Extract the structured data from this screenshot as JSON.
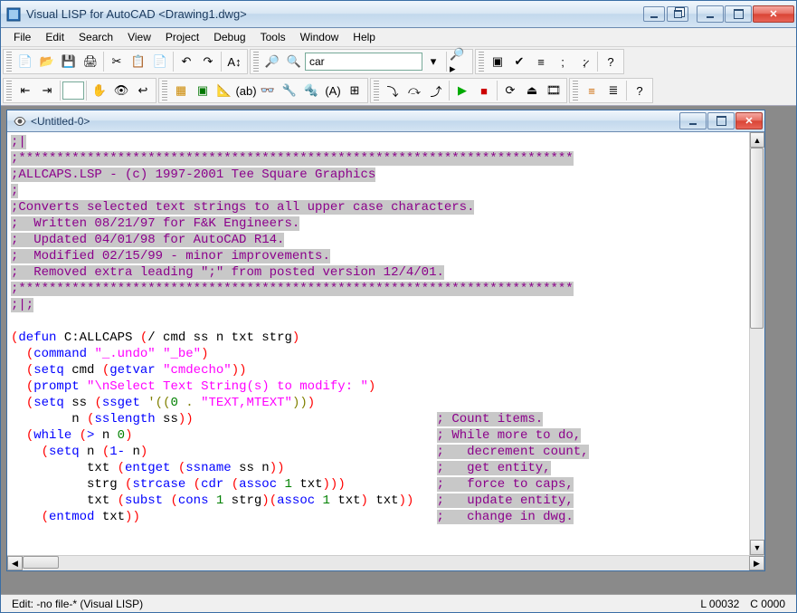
{
  "window": {
    "title": "Visual LISP for AutoCAD <Drawing1.dwg>"
  },
  "menu": {
    "items": [
      "File",
      "Edit",
      "Search",
      "View",
      "Project",
      "Debug",
      "Tools",
      "Window",
      "Help"
    ]
  },
  "toolbar": {
    "search_value": "car"
  },
  "child": {
    "title": "<Untitled-0>"
  },
  "code": {
    "lines": [
      {
        "t": "cmt",
        "raw": ";|"
      },
      {
        "t": "cmt",
        "raw": ";*************************************************************************"
      },
      {
        "t": "cmt",
        "raw": ";ALLCAPS.LSP - (c) 1997-2001 Tee Square Graphics"
      },
      {
        "t": "cmt",
        "raw": ";"
      },
      {
        "t": "cmt",
        "raw": ";Converts selected text strings to all upper case characters."
      },
      {
        "t": "cmt",
        "raw": ";  Written 08/21/97 for F&K Engineers."
      },
      {
        "t": "cmt",
        "raw": ";  Updated 04/01/98 for AutoCAD R14."
      },
      {
        "t": "cmt",
        "raw": ";  Modified 02/15/99 - minor improvements."
      },
      {
        "t": "cmt",
        "raw": ";  Removed extra leading \";\" from posted version 12/4/01."
      },
      {
        "t": "cmt",
        "raw": ";*************************************************************************"
      },
      {
        "t": "cmt",
        "raw": ";|;"
      },
      {
        "t": "blank",
        "raw": ""
      },
      {
        "t": "code",
        "seg": [
          [
            "paren",
            "("
          ],
          [
            "func",
            "defun"
          ],
          [
            "sym",
            " C:ALLCAPS "
          ],
          [
            "paren",
            "("
          ],
          [
            "sym",
            "/ cmd ss n txt strg"
          ],
          [
            "paren",
            ")"
          ]
        ]
      },
      {
        "t": "code",
        "indent": "  ",
        "seg": [
          [
            "paren",
            "("
          ],
          [
            "func",
            "command"
          ],
          [
            "sym",
            " "
          ],
          [
            "str",
            "\"_.undo\""
          ],
          [
            "sym",
            " "
          ],
          [
            "str",
            "\"_be\""
          ],
          [
            "paren",
            ")"
          ]
        ]
      },
      {
        "t": "code",
        "indent": "  ",
        "seg": [
          [
            "paren",
            "("
          ],
          [
            "func",
            "setq"
          ],
          [
            "sym",
            " cmd "
          ],
          [
            "paren",
            "("
          ],
          [
            "func",
            "getvar"
          ],
          [
            "sym",
            " "
          ],
          [
            "str",
            "\"cmdecho\""
          ],
          [
            "paren",
            "))"
          ]
        ]
      },
      {
        "t": "code",
        "indent": "  ",
        "seg": [
          [
            "paren",
            "("
          ],
          [
            "func",
            "prompt"
          ],
          [
            "sym",
            " "
          ],
          [
            "str",
            "\"\\nSelect Text String(s) to modify: \""
          ],
          [
            "paren",
            ")"
          ]
        ]
      },
      {
        "t": "code",
        "indent": "  ",
        "seg": [
          [
            "paren",
            "("
          ],
          [
            "func",
            "setq"
          ],
          [
            "sym",
            " ss "
          ],
          [
            "paren",
            "("
          ],
          [
            "func",
            "ssget"
          ],
          [
            "sym",
            " "
          ],
          [
            "quote",
            "'(("
          ],
          [
            "num",
            "0"
          ],
          [
            "quote",
            " . "
          ],
          [
            "str",
            "\"TEXT,MTEXT\""
          ],
          [
            "quote",
            "))"
          ],
          [
            "paren",
            ")"
          ]
        ],
        "cmt": null
      },
      {
        "t": "code",
        "indent": "        ",
        "seg": [
          [
            "sym",
            "n "
          ],
          [
            "paren",
            "("
          ],
          [
            "func",
            "sslength"
          ],
          [
            "sym",
            " ss"
          ],
          [
            "paren",
            "))"
          ]
        ],
        "cmt": "; Count items."
      },
      {
        "t": "code",
        "indent": "  ",
        "seg": [
          [
            "paren",
            "("
          ],
          [
            "func",
            "while"
          ],
          [
            "sym",
            " "
          ],
          [
            "paren",
            "("
          ],
          [
            "func",
            ">"
          ],
          [
            "sym",
            " n "
          ],
          [
            "num",
            "0"
          ],
          [
            "paren",
            ")"
          ]
        ],
        "cmt": "; While more to do,"
      },
      {
        "t": "code",
        "indent": "    ",
        "seg": [
          [
            "paren",
            "("
          ],
          [
            "func",
            "setq"
          ],
          [
            "sym",
            " n "
          ],
          [
            "paren",
            "("
          ],
          [
            "func",
            "1-"
          ],
          [
            "sym",
            " n"
          ],
          [
            "paren",
            ")"
          ]
        ],
        "cmt": ";   decrement count,"
      },
      {
        "t": "code",
        "indent": "          ",
        "seg": [
          [
            "sym",
            "txt "
          ],
          [
            "paren",
            "("
          ],
          [
            "func",
            "entget"
          ],
          [
            "sym",
            " "
          ],
          [
            "paren",
            "("
          ],
          [
            "func",
            "ssname"
          ],
          [
            "sym",
            " ss n"
          ],
          [
            "paren",
            "))"
          ]
        ],
        "cmt": ";   get entity,"
      },
      {
        "t": "code",
        "indent": "          ",
        "seg": [
          [
            "sym",
            "strg "
          ],
          [
            "paren",
            "("
          ],
          [
            "func",
            "strcase"
          ],
          [
            "sym",
            " "
          ],
          [
            "paren",
            "("
          ],
          [
            "func",
            "cdr"
          ],
          [
            "sym",
            " "
          ],
          [
            "paren",
            "("
          ],
          [
            "func",
            "assoc"
          ],
          [
            "sym",
            " "
          ],
          [
            "num",
            "1"
          ],
          [
            "sym",
            " txt"
          ],
          [
            "paren",
            ")))"
          ]
        ],
        "cmt": ";   force to caps,"
      },
      {
        "t": "code",
        "indent": "          ",
        "seg": [
          [
            "sym",
            "txt "
          ],
          [
            "paren",
            "("
          ],
          [
            "func",
            "subst"
          ],
          [
            "sym",
            " "
          ],
          [
            "paren",
            "("
          ],
          [
            "func",
            "cons"
          ],
          [
            "sym",
            " "
          ],
          [
            "num",
            "1"
          ],
          [
            "sym",
            " strg"
          ],
          [
            "paren",
            ")("
          ],
          [
            "func",
            "assoc"
          ],
          [
            "sym",
            " "
          ],
          [
            "num",
            "1"
          ],
          [
            "sym",
            " txt"
          ],
          [
            "paren",
            ")"
          ],
          [
            "sym",
            " txt"
          ],
          [
            "paren",
            "))"
          ]
        ],
        "cmt": ";   update entity,"
      },
      {
        "t": "code",
        "indent": "    ",
        "seg": [
          [
            "paren",
            "("
          ],
          [
            "func",
            "entmod"
          ],
          [
            "sym",
            " txt"
          ],
          [
            "paren",
            "))"
          ]
        ],
        "cmt": ";   change in dwg."
      }
    ],
    "comment_column": 56
  },
  "status": {
    "left": "Edit: -no file-* (Visual LISP)",
    "line": "L 00032",
    "col": "C 0000"
  }
}
